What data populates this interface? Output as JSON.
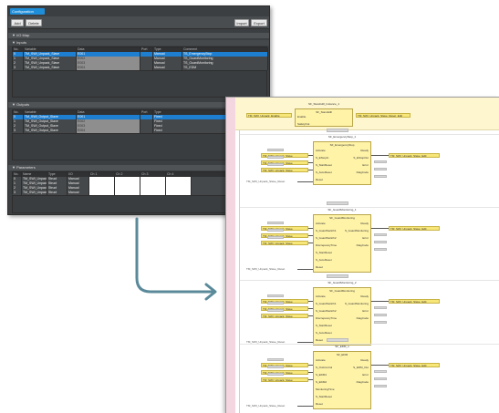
{
  "config_window": {
    "tab_label": "Configuration",
    "toolbar": {
      "left_buttons": [
        "Add",
        "Delete"
      ],
      "right_buttons": [
        "Import",
        "Export"
      ]
    },
    "section1": {
      "title": "▼ I/O Map",
      "sub": "▼ Inputs",
      "columns": [
        "No.",
        "Variable",
        "Data",
        "Port",
        "Type",
        "Comment"
      ],
      "rows": [
        [
          "0",
          "TM_SWI_Unpack_Slave",
          "E001",
          "",
          "Manual",
          "TS_EmergencyStop"
        ],
        [
          "1",
          "TM_SWI_Unpack_Slave",
          "E002",
          "",
          "Manual",
          "TS_GuardMonitoring"
        ],
        [
          "2",
          "TM_SWI_Unpack_Slave",
          "E003",
          "",
          "Manual",
          "TS_GuardMonitoring"
        ],
        [
          "3",
          "TM_SWI_Unpack_Slave",
          "E004",
          "",
          "Manual",
          "TS_EDM"
        ]
      ]
    },
    "section2": {
      "title": "▼ Outputs",
      "columns": [
        "No.",
        "Variable",
        "Data",
        "Port",
        "Type"
      ],
      "rows": [
        [
          "0",
          "TM_SWI_Output_Slave",
          "E001",
          "",
          "Fixed"
        ],
        [
          "1",
          "TM_SWI_Output_Slave",
          "E002",
          "",
          "Fixed"
        ],
        [
          "2",
          "TM_SWI_Output_Slave",
          "E003",
          "",
          "Fixed"
        ],
        [
          "3",
          "TM_SWI_Output_Slave",
          "E004",
          "",
          "Fixed"
        ]
      ]
    },
    "section3": {
      "title": "▼ Parameters",
      "columns": [
        "No.",
        "Name",
        "Type",
        "I/O",
        "Ch 1",
        "Ch 2",
        "Ch 3",
        "Ch 4"
      ],
      "rows": [
        [
          "0",
          "TM_SWI_Unpack_Slave",
          "Struct",
          "Manual"
        ],
        [
          "1",
          "TM_SWI_Unpack_Slave",
          "Struct",
          "Manual"
        ],
        [
          "2",
          "TM_SWI_Unpack_Slave",
          "Struct",
          "Manual"
        ],
        [
          "3",
          "TM_SWI_Unpack_Slave",
          "Struct",
          "Manual"
        ]
      ]
    }
  },
  "ladder": {
    "top_block": {
      "title": "SF_Standstill_Instance_1",
      "type": "SF_Standstill",
      "in_pins": [
        "Enable",
        "",
        "",
        "SafetyOut"
      ],
      "out_var": "TM_SWI_Unpack_Slave_Reset_Edit",
      "in_var": "TM_SWI_Unpack_Enable"
    },
    "blocks": [
      {
        "title": "SF_EmergencyStop_1",
        "type": "SF_EmergencyStop",
        "in_pins": [
          "Activate",
          "S_EStopIn",
          "S_StartReset",
          "S_AutoReset",
          "Reset"
        ],
        "out_pins": [
          "Ready",
          "S_EStopOut",
          "Error",
          "DiagCode"
        ],
        "in_vars": [
          "TM_SWI_Unpack_Slave",
          "TM_SWI_Unpack_Slave",
          "TM_SWI_Unpack_Slave"
        ],
        "out_var": "TM_SWI_Unpack_Slave_Edit",
        "reset_var": "TM_SWI_Unpack_Slave_Reset"
      },
      {
        "title": "SF_GuardMonitoring_1",
        "type": "SF_GuardMonitoring",
        "in_pins": [
          "Activate",
          "S_GuardSwitch1",
          "S_GuardSwitch2",
          "DiscrepancyTime",
          "S_StartReset",
          "S_AutoReset",
          "Reset"
        ],
        "out_pins": [
          "Ready",
          "S_GuardMonitoring",
          "Error",
          "DiagCode"
        ],
        "in_vars": [
          "TM_SWI_Unpack_Slave",
          "TM_SWI_Unpack_Slave",
          "TM_SWI_Unpack_Slave"
        ],
        "out_var": "TM_SWI_Unpack_Slave_Edit",
        "reset_var": "TM_SWI_Unpack_Slave_Reset"
      },
      {
        "title": "SF_GuardMonitoring_2",
        "type": "SF_GuardMonitoring",
        "in_pins": [
          "Activate",
          "S_GuardSwitch1",
          "S_GuardSwitch2",
          "DiscrepancyTime",
          "S_StartReset",
          "S_AutoReset",
          "Reset"
        ],
        "out_pins": [
          "Ready",
          "S_GuardMonitoring",
          "Error",
          "DiagCode"
        ],
        "in_vars": [
          "TM_SWI_Unpack_Slave",
          "TM_SWI_Unpack_Slave",
          "TM_SWI_Unpack_Slave"
        ],
        "out_var": "TM_SWI_Unpack_Slave_Edit",
        "reset_var": "TM_SWI_Unpack_Slave_Reset"
      },
      {
        "title": "SF_EDM_1",
        "type": "SF_EDM",
        "in_pins": [
          "Activate",
          "S_OutControl",
          "S_EDM1",
          "S_EDM2",
          "MonitoringTime",
          "S_StartReset",
          "Reset"
        ],
        "out_pins": [
          "Ready",
          "S_EDM_Out",
          "Error",
          "DiagCode"
        ],
        "in_vars": [
          "TM_SWI_Unpack_Slave",
          "TM_SWI_Unpack_Slave",
          "TM_SWI_Unpack_Slave"
        ],
        "out_var": "TM_SWI_Unpack_Slave_Edit",
        "reset_var": "TM_SWI_Unpack_Slave_Reset"
      }
    ]
  },
  "colors": {
    "dark_bg": "#3c3f41",
    "selection": "#1e7fd0",
    "block_fill": "#fff3a8",
    "variable_fill": "#f7e67a",
    "arrow": "#5a8a9a"
  }
}
